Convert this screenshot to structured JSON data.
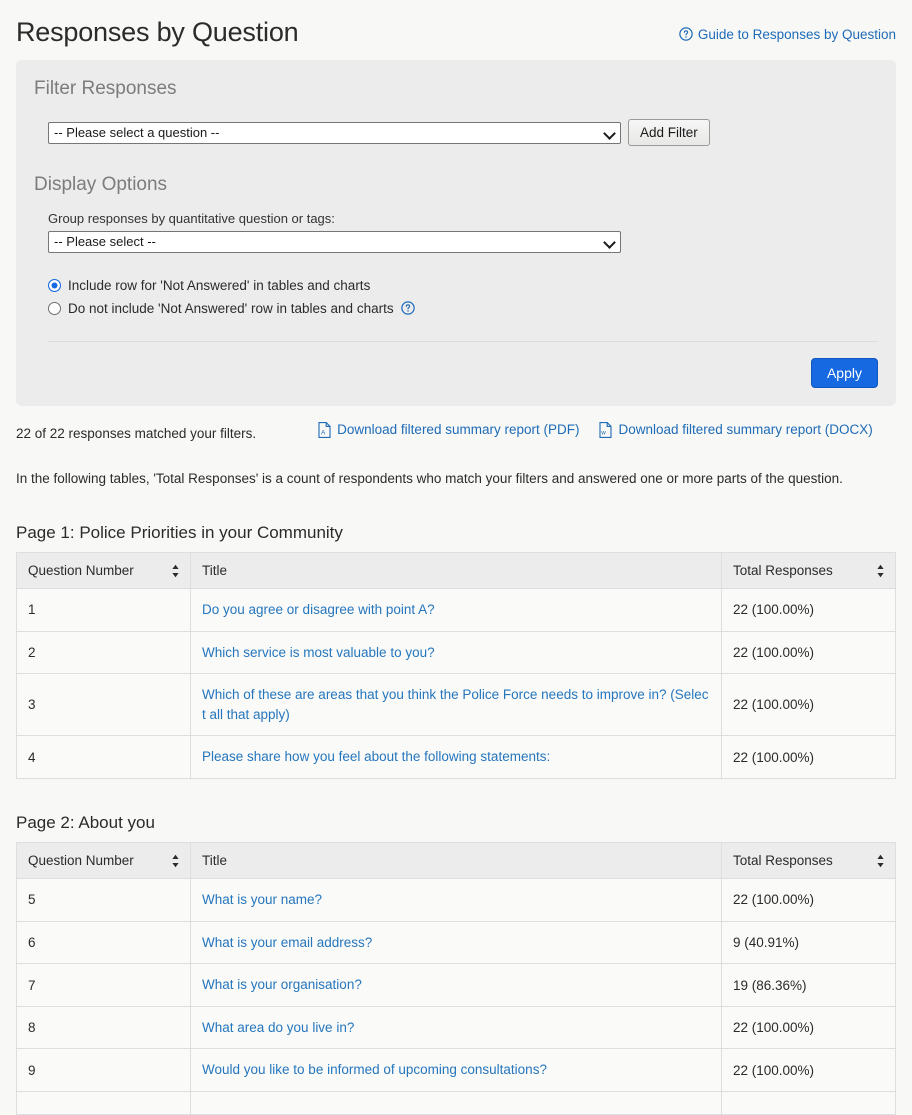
{
  "header": {
    "title": "Responses by Question",
    "guide_link": "Guide to Responses by Question",
    "guide_icon": "help-circle-icon"
  },
  "filter_panel": {
    "heading": "Filter Responses",
    "question_select": {
      "value": "-- Please select a question --",
      "options": [
        "-- Please select a question --"
      ]
    },
    "add_filter_label": "Add Filter",
    "display_options_heading": "Display Options",
    "group_label": "Group responses by quantitative question or tags:",
    "group_select": {
      "value": "-- Please select --",
      "options": [
        "-- Please select --"
      ]
    },
    "radio_options": [
      {
        "label": "Include row for 'Not Answered' in tables and charts",
        "checked": true,
        "help": false
      },
      {
        "label": "Do not include 'Not Answered' row in tables and charts",
        "checked": false,
        "help": true
      }
    ],
    "help_icon": "help-circle-icon",
    "apply_label": "Apply"
  },
  "meta": {
    "match_count": "22 of 22 responses matched your filters.",
    "downloads": [
      {
        "label": "Download filtered summary report (PDF)",
        "icon": "pdf-file-icon"
      },
      {
        "label": "Download filtered summary report (DOCX)",
        "icon": "docx-file-icon"
      }
    ],
    "note": "In the following tables, 'Total Responses' is a count of respondents who match your filters and answered one or more parts of the question."
  },
  "tables": [
    {
      "section_title": "Page 1: Police Priorities in your Community",
      "columns": [
        "Question Number",
        "Title",
        "Total Responses"
      ],
      "rows": [
        {
          "number": "1",
          "title": "Do you agree or disagree with point A?",
          "responses": "22 (100.00%)"
        },
        {
          "number": "2",
          "title": "Which service is most valuable to you?",
          "responses": "22 (100.00%)"
        },
        {
          "number": "3",
          "title": "Which of these are areas that you think the Police Force needs to improve in? (Select all that apply)",
          "responses": "22 (100.00%)"
        },
        {
          "number": "4",
          "title": "Please share how you feel about the following statements:",
          "responses": "22 (100.00%)"
        }
      ]
    },
    {
      "section_title": "Page 2: About you",
      "columns": [
        "Question Number",
        "Title",
        "Total Responses"
      ],
      "rows": [
        {
          "number": "5",
          "title": "What is your name?",
          "responses": "22 (100.00%)"
        },
        {
          "number": "6",
          "title": "What is your email address?",
          "responses": "9 (40.91%)"
        },
        {
          "number": "7",
          "title": "What is your organisation?",
          "responses": "19 (86.36%)"
        },
        {
          "number": "8",
          "title": "What area do you live in?",
          "responses": "22 (100.00%)"
        },
        {
          "number": "9",
          "title": "Would you like to be informed of upcoming consultations?",
          "responses": "22 (100.00%)"
        }
      ]
    }
  ],
  "colors": {
    "link": "#2576bd",
    "primary_button": "#1669e0",
    "panel_bg": "#ececec",
    "page_bg": "#f8f8f6"
  }
}
